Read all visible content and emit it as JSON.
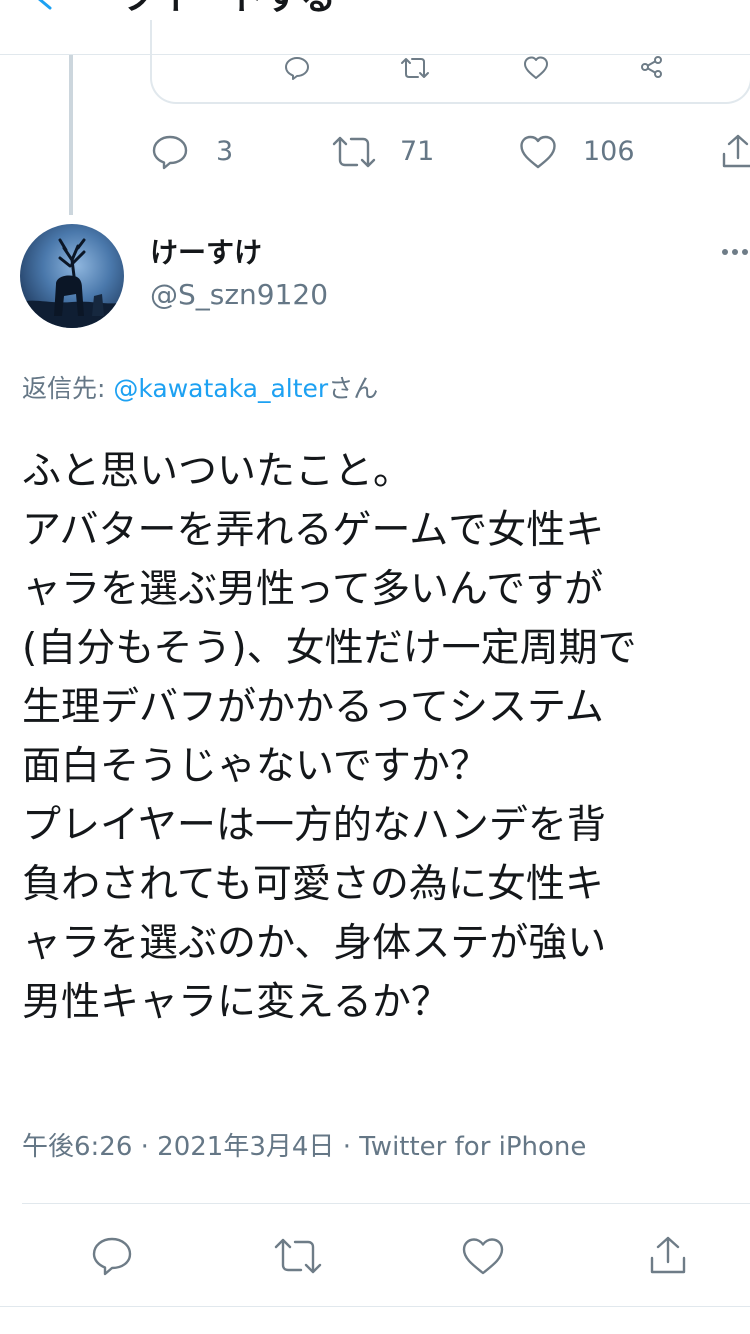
{
  "header": {
    "title": "ツイートする"
  },
  "parent_tweet": {
    "stats": {
      "replies": "3",
      "retweets": "71",
      "likes": "106"
    }
  },
  "tweet": {
    "display_name": "けーすけ",
    "handle": "@S_szn9120",
    "reply_prefix": "返信先: ",
    "reply_mention": "@kawataka_alter",
    "reply_suffix": "さん",
    "lines": [
      "ふと思いついたこと。",
      "アバターを弄れるゲームで女性キ",
      "ャラを選ぶ男性って多いんですが",
      "(自分もそう)、女性だけ一定周期で",
      "生理デバフがかかるってシステム",
      "面白そうじゃないですか？",
      "プレイヤーは一方的なハンデを背",
      "負わされても可愛さの為に女性キ",
      "ャラを選ぶのか、身体ステが強い",
      "男性キャラに変えるか？"
    ],
    "meta": "午後6:26 · 2021年3月4日 · Twitter for iPhone"
  },
  "icons": [
    "back-chevron-icon",
    "reply-icon",
    "retweet-icon",
    "like-icon",
    "share-icon",
    "more-icon"
  ],
  "colors": {
    "link": "#1da1f2",
    "icon": "#6e7c87",
    "divider": "#e1e8ed",
    "text": "#14171a",
    "muted": "#657786"
  }
}
